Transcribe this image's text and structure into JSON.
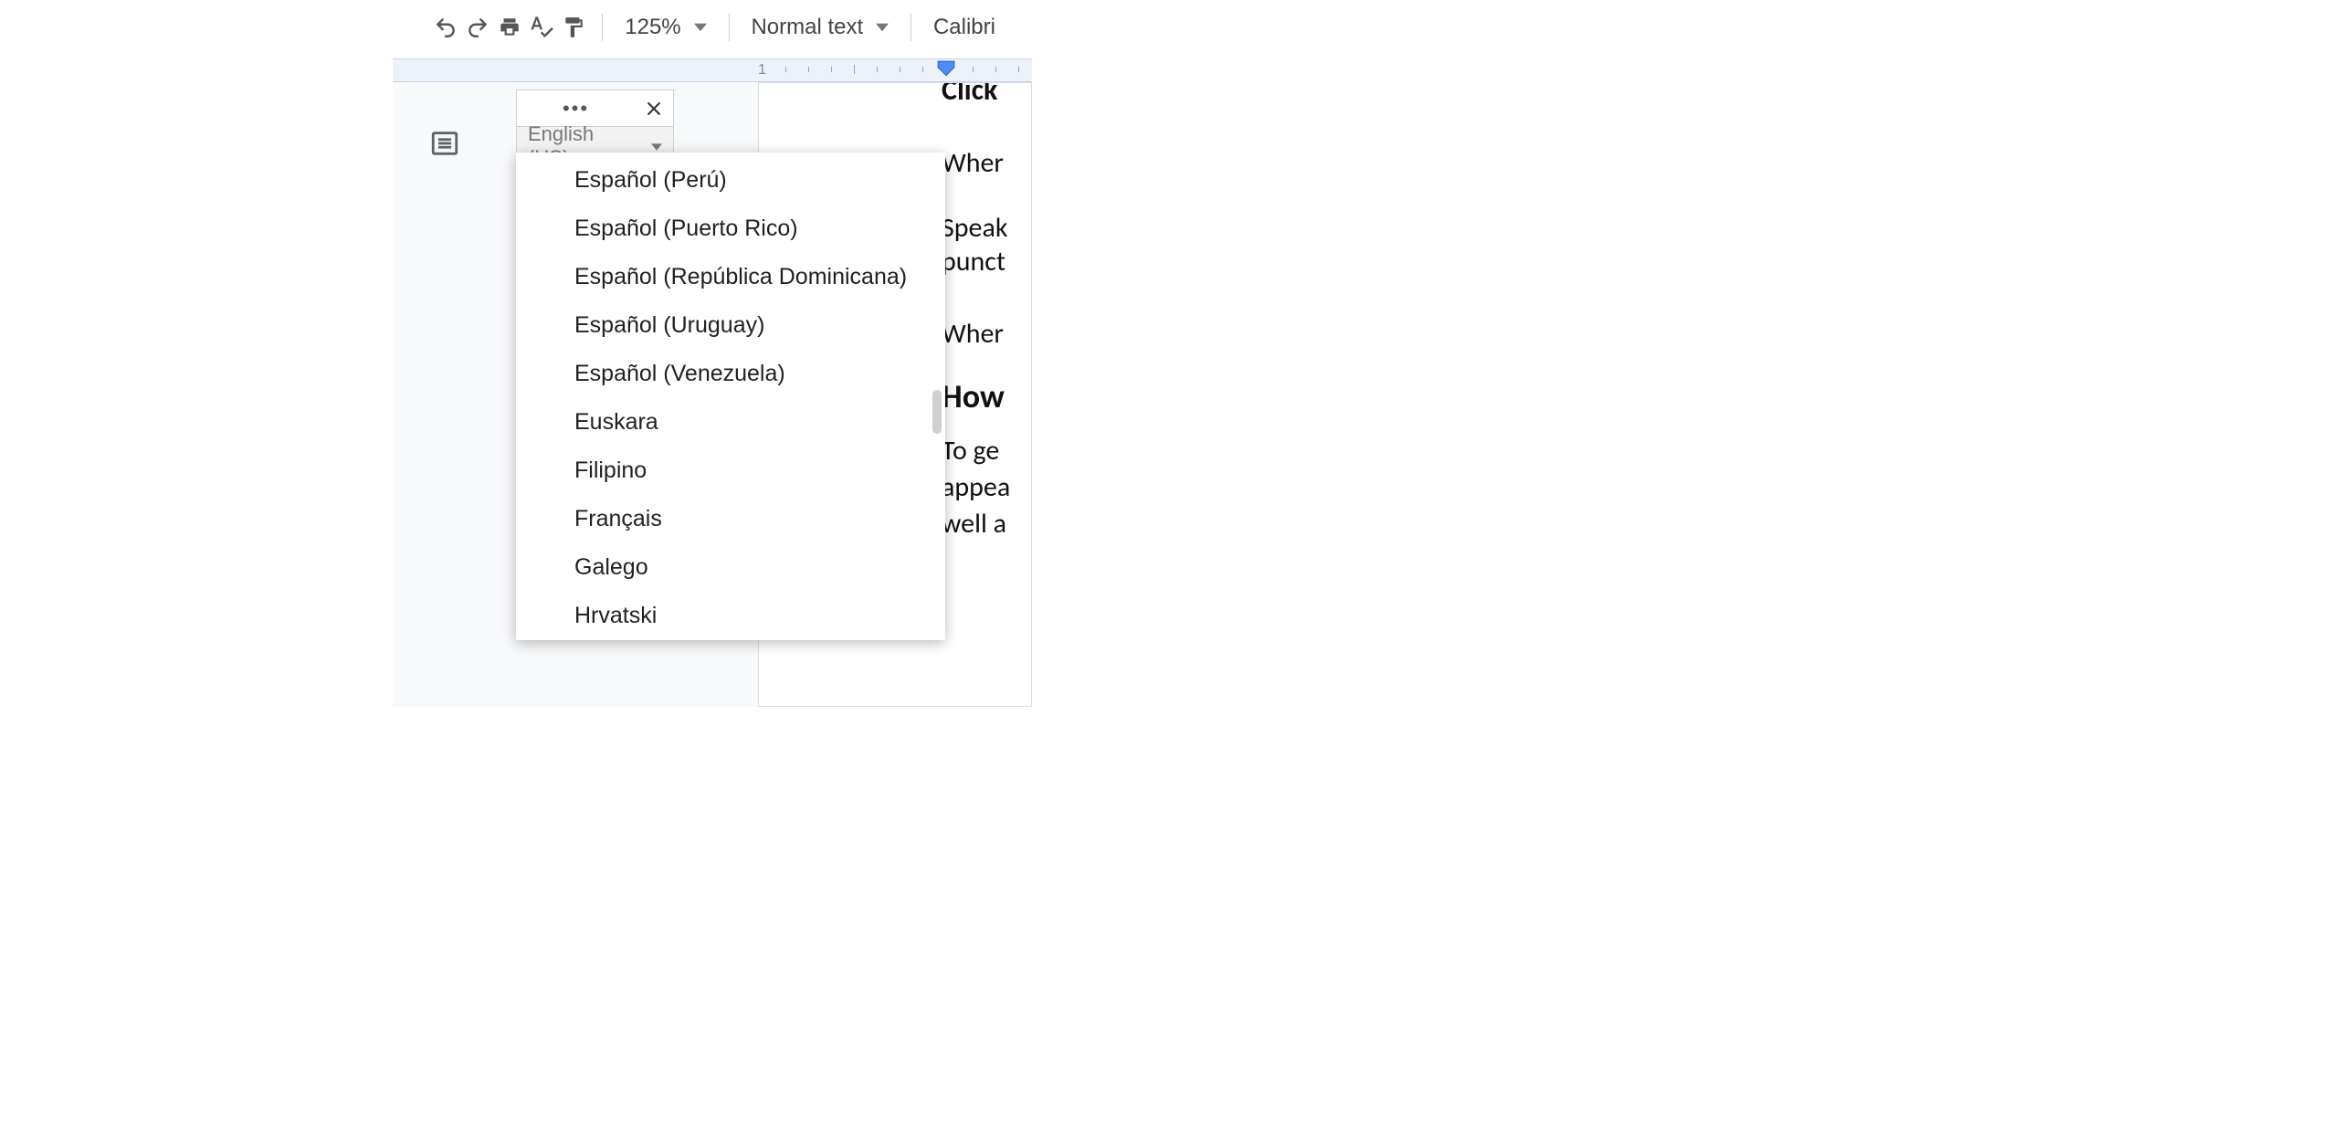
{
  "toolbar": {
    "zoom": "125%",
    "style": "Normal text",
    "font": "Calibri"
  },
  "ruler": {
    "label1": "1"
  },
  "voice": {
    "selected_language": "English (US)",
    "dropdown_options": [
      "Español (Perú)",
      "Español (Puerto Rico)",
      "Español (República Dominicana)",
      "Español (Uruguay)",
      "Español (Venezuela)",
      "Euskara",
      "Filipino",
      "Français",
      "Galego",
      "Hrvatski"
    ]
  },
  "document": {
    "line0": "Click",
    "line1": "Wher",
    "line2a": "Speak",
    "line2b": "punct",
    "line3": "Wher",
    "heading": "How",
    "p1a": "To ge",
    "p1b": "appea",
    "p1c": "well a"
  }
}
